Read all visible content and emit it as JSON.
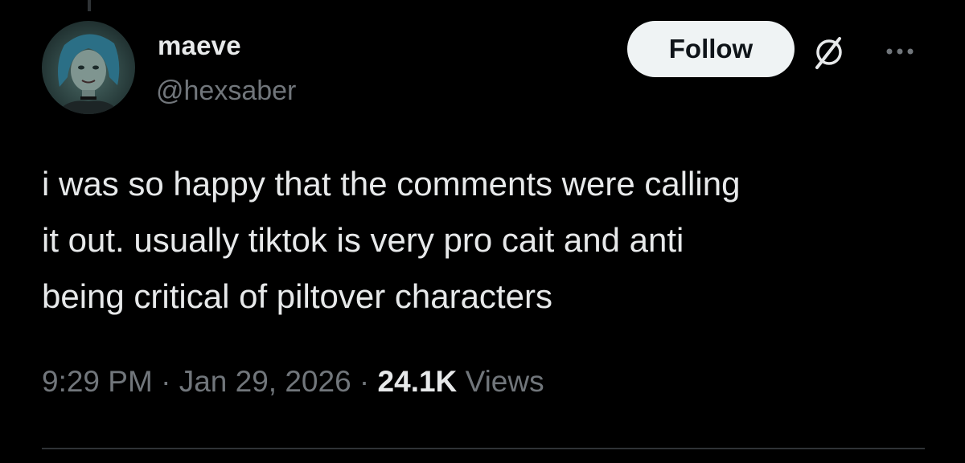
{
  "author": {
    "display_name": "maeve",
    "handle": "@hexsaber",
    "avatar_icon": "avatar-illustration"
  },
  "actions": {
    "follow_label": "Follow",
    "grok_icon": "grok-icon",
    "more_icon": "more-dots-icon"
  },
  "tweet": {
    "text": "i was so happy that the comments were calling\nit out. usually tiktok is very pro cait and anti\nbeing critical of piltover characters",
    "time": "9:29 PM",
    "separator": " · ",
    "date": "Jan 29, 2026",
    "views_count": "24.1K",
    "views_label": "Views"
  },
  "colors": {
    "background": "#000000",
    "primary_text": "#e7e9ea",
    "secondary_text": "#71767b",
    "follow_bg": "#eff3f4",
    "divider": "#2f3336"
  }
}
